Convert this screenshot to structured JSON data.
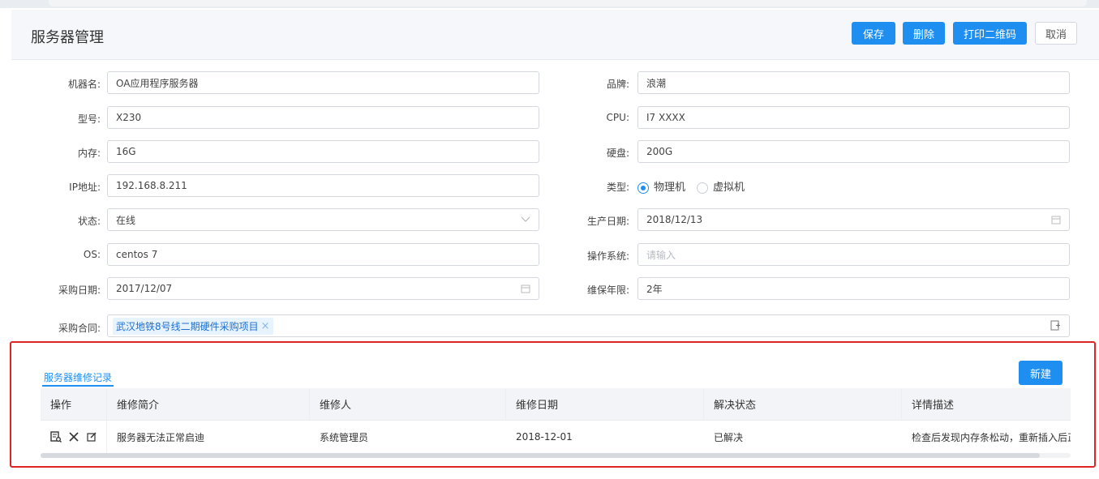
{
  "header": {
    "title": "服务器管理",
    "buttons": {
      "save": "保存",
      "delete": "删除",
      "print_qr": "打印二维码",
      "cancel": "取消"
    }
  },
  "form": {
    "machine_name": {
      "label": "机器名:",
      "value": "OA应用程序服务器"
    },
    "brand": {
      "label": "品牌:",
      "value": "浪潮"
    },
    "model": {
      "label": "型号:",
      "value": "X230"
    },
    "cpu": {
      "label": "CPU:",
      "value": "I7 XXXX"
    },
    "memory": {
      "label": "内存:",
      "value": "16G"
    },
    "disk": {
      "label": "硬盘:",
      "value": "200G"
    },
    "ip": {
      "label": "IP地址:",
      "value": "192.168.8.211"
    },
    "type": {
      "label": "类型:",
      "options": [
        "物理机",
        "虚拟机"
      ],
      "selected": "物理机"
    },
    "status": {
      "label": "状态:",
      "value": "在线"
    },
    "production_date": {
      "label": "生产日期:",
      "value": "2018/12/13"
    },
    "os": {
      "label": "OS:",
      "value": "centos 7"
    },
    "operating_system": {
      "label": "操作系统:",
      "placeholder": "请输入"
    },
    "purchase_date": {
      "label": "采购日期:",
      "value": "2017/12/07"
    },
    "warranty": {
      "label": "维保年限:",
      "value": "2年"
    },
    "purchase_contract": {
      "label": "采购合同:",
      "tag": "武汉地铁8号线二期硬件采购项目"
    }
  },
  "maintenance": {
    "tab": "服务器维修记录",
    "new_button": "新建",
    "columns": [
      "操作",
      "维修简介",
      "维修人",
      "维修日期",
      "解决状态",
      "详情描述"
    ],
    "rows": [
      {
        "summary": "服务器无法正常启迪",
        "person": "系统管理员",
        "date": "2018-12-01",
        "status": "已解决",
        "detail": "检查后发现内存条松动，重新插入后正"
      }
    ]
  },
  "icons": {
    "calendar": "calendar-icon",
    "chevron": "chevron-down-icon",
    "add": "add-icon",
    "view": "view-icon",
    "delete": "close-icon",
    "edit": "edit-icon"
  },
  "colors": {
    "primary": "#1e8ff0",
    "highlight_border": "#e02424"
  }
}
